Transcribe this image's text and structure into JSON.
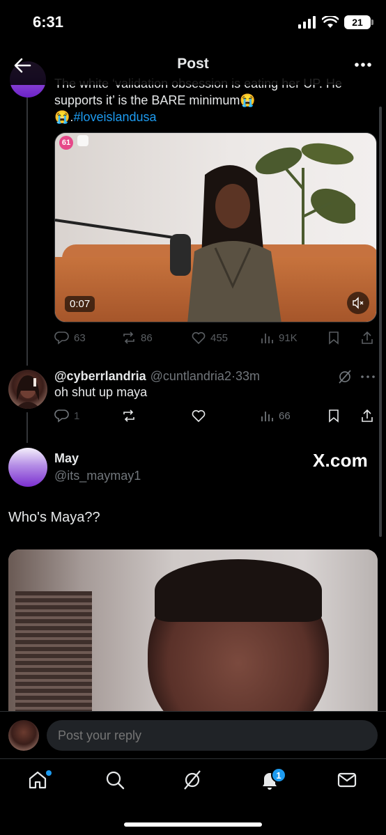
{
  "status_bar": {
    "time": "6:31",
    "battery": "21"
  },
  "header": {
    "title": "Post"
  },
  "top_tweet": {
    "text_line1": "The white ‘validation obsession is eating her UP. He",
    "text_line2": "supports it’ is the BARE minimum",
    "text_line3_prefix": ".",
    "hashtag": "#loveislandusa",
    "video": {
      "badge": "61",
      "duration": "0:07"
    },
    "actions": {
      "replies": "63",
      "reposts": "86",
      "likes": "455",
      "views": "91K"
    }
  },
  "reply": {
    "name": "@cyberrlandria",
    "handle": "@cuntlandria2",
    "separator": "·",
    "time": "33m",
    "text": "oh shut up maya",
    "actions": {
      "replies": "1",
      "views": "66"
    }
  },
  "quoted_post": {
    "name": "May",
    "handle": "@its_maymay1",
    "watermark": "X.com",
    "text": "Who's Maya??"
  },
  "compose": {
    "placeholder": "Post your reply"
  },
  "tabs": [
    {
      "name": "home",
      "icon": "home-icon"
    },
    {
      "name": "search",
      "icon": "search-icon"
    },
    {
      "name": "grok",
      "icon": "grok-icon"
    },
    {
      "name": "notifications",
      "icon": "bell-icon",
      "badge": "1"
    },
    {
      "name": "messages",
      "icon": "mail-icon"
    }
  ],
  "colors": {
    "accent": "#1d9bf0",
    "background": "#000000",
    "muted": "#71767b"
  }
}
